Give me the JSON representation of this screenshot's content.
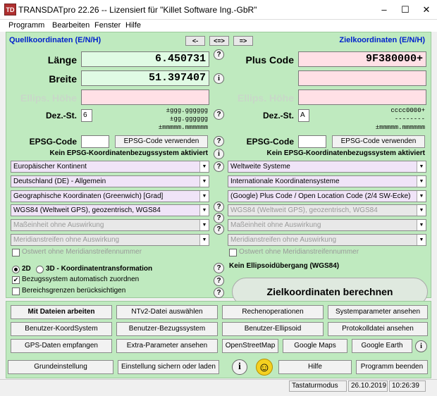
{
  "window": {
    "title": "TRANSDATpro 22.26 -- Lizensiert für \"Killet Software Ing.-GbR\"",
    "icon": "app-icon",
    "minimize": "–",
    "maximize": "☐",
    "close": "✕"
  },
  "menu": [
    "Programm",
    "Bearbeiten",
    "Fenster",
    "Hilfe"
  ],
  "left": {
    "header": "Quellkoordinaten (E/N/H)",
    "fields": [
      {
        "label": "Länge",
        "value": "6.450731"
      },
      {
        "label": "Breite",
        "value": "51.397407"
      },
      {
        "label": "Ellips. Höhe",
        "value": ""
      }
    ],
    "dez_label": "Dez.-St.",
    "dez_value": "6",
    "format_lines": [
      "±ggg.gggggg",
      "±gg.gggggg",
      "±mmmmm.mmmmmm"
    ],
    "epsg_label": "EPSG-Code",
    "epsg_value": "",
    "epsg_button": "EPSG-Code verwenden",
    "epsg_note": "Kein EPSG-Koordinatenbezugssystem aktiviert",
    "combos": [
      "Europäischer Kontinent",
      "Deutschland (DE) - Allgemein",
      "Geographische Koordinaten (Greenwich) [Grad]",
      "WGS84 (Weltweit GPS), geozentrisch, WGS84",
      "Maßeinheit ohne Auswirkung",
      "Meridianstreifen ohne Auswirkung"
    ],
    "ostwert_label": "Ostwert ohne Meridianstreifennummer"
  },
  "right": {
    "header": "Zielkoordinaten (E/N/H)",
    "fields": [
      {
        "label": "Plus Code",
        "value": "9F380000+"
      },
      {
        "label": "",
        "value": ""
      },
      {
        "label": "Ellips. Höhe",
        "value": ""
      }
    ],
    "dez_label": "Dez.-St.",
    "dez_value": "A",
    "format_lines": [
      "cccc0000+",
      "--------",
      "±mmmmm.mmmmmm"
    ],
    "epsg_label": "EPSG-Code",
    "epsg_value": "",
    "epsg_button": "EPSG-Code verwenden",
    "epsg_note": "Kein EPSG-Koordinatenbezugssystem aktiviert",
    "combos": [
      "Weltweite Systeme",
      "Internationale Koordinatensysteme",
      "(Google) Plus Code / Open Location Code (2/4 SW-Ecke)",
      "WGS84 (Weltweit GPS), geozentrisch, WGS84",
      "Maßeinheit ohne Auswirkung",
      "Meridianstreifen ohne Auswirkung"
    ],
    "ostwert_label": "Ostwert ohne Meridianstreifennummer"
  },
  "arrows": [
    "<-",
    "<=>",
    "=>"
  ],
  "options": {
    "radio_2d": "2D",
    "radio_3d": "3D - Koordinatentransformation",
    "bezug": "Bezugssystem automatisch zuordnen",
    "bereich": "Bereichsgrenzen berücksichtigen",
    "ellipsoid_note": "Kein Ellipsoidübergang (WGS84)",
    "calc_button": "Zielkoordinaten berechnen"
  },
  "buttons": {
    "row1": [
      "Mit Dateien arbeiten",
      "NTv2-Datei auswählen",
      "Rechenoperationen",
      "Systemparameter ansehen"
    ],
    "row2": [
      "Benutzer-KoordSystem",
      "Benutzer-Bezugssystem",
      "Benutzer-Ellipsoid",
      "Protokolldatei ansehen"
    ],
    "row3": [
      "GPS-Daten empfangen",
      "Extra-Parameter ansehen",
      "OpenStreetMap",
      "Google Maps",
      "Google Earth"
    ],
    "row4": [
      "Grundeinstellung",
      "Einstellung sichern oder laden",
      "Hilfe",
      "Programm beenden"
    ]
  },
  "status": {
    "mode": "Tastaturmodus",
    "date": "26.10.2019",
    "time": "10:26:39"
  },
  "glyphs": {
    "q": "?",
    "i": "i",
    "check": "✔",
    "dropdown": "▼",
    "smiley": "☺"
  }
}
